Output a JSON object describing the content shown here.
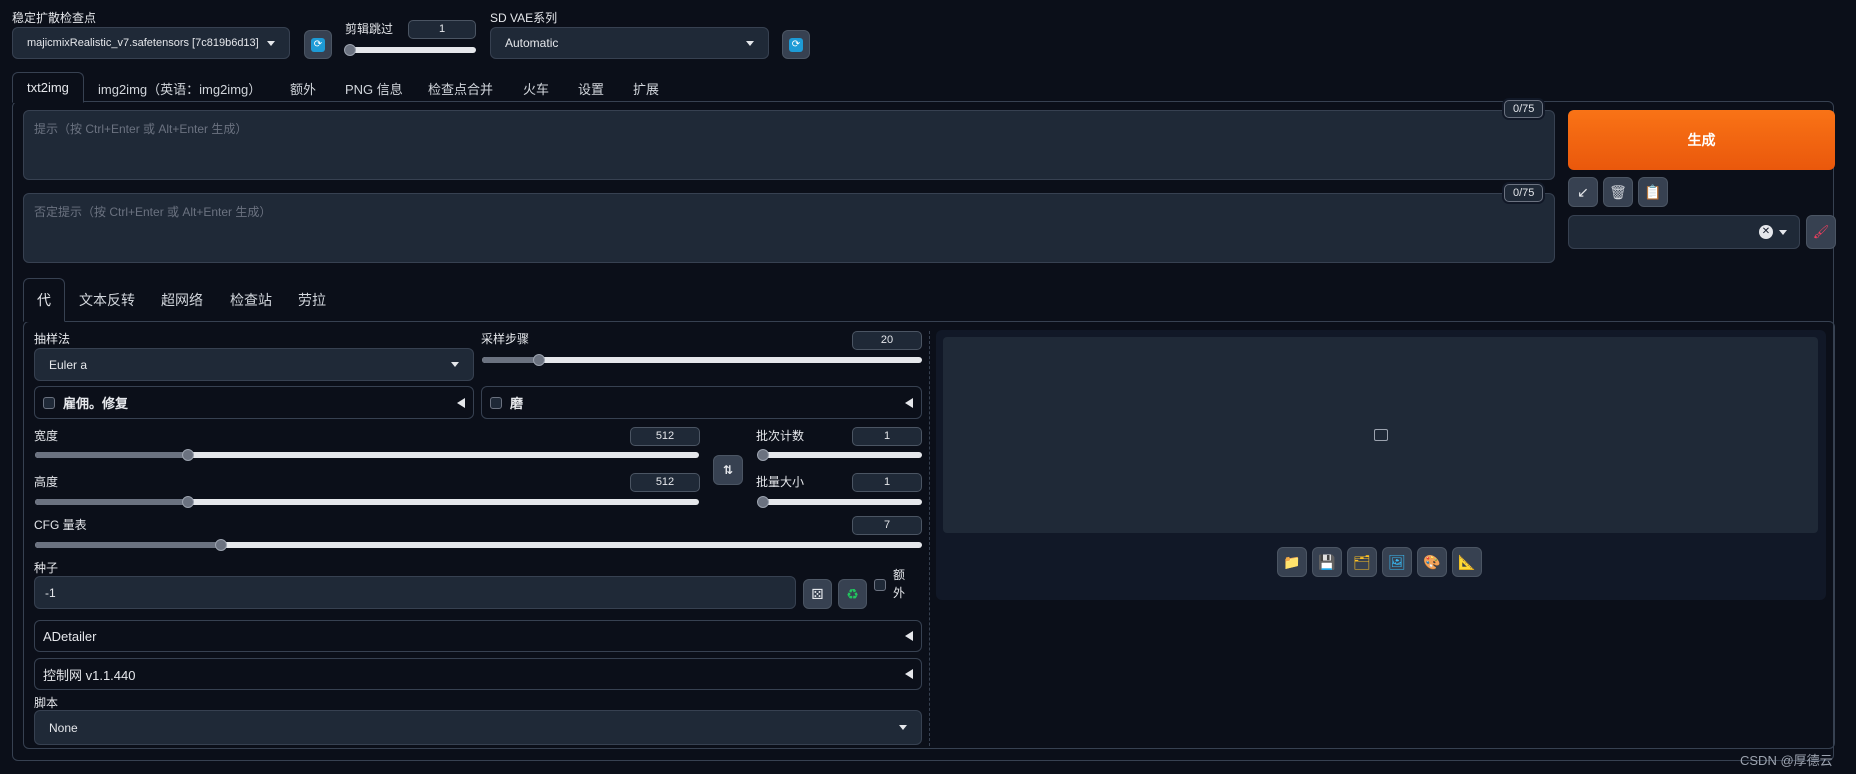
{
  "header": {
    "checkpoint_label": "稳定扩散检查点",
    "checkpoint_value": "majicmixRealistic_v7.safetensors [7c819b6d13]",
    "clip_skip_label": "剪辑跳过",
    "clip_skip_value": "1",
    "clip_skip_level": 0.0,
    "vae_label": "SD VAE系列",
    "vae_value": "Automatic"
  },
  "main_tabs": [
    "txt2img",
    "img2img（英语：img2img）",
    "额外",
    "PNG 信息",
    "检查点合并",
    "火车",
    "设置",
    "扩展"
  ],
  "prompt": {
    "placeholder": "提示（按 Ctrl+Enter 或 Alt+Enter 生成）",
    "counter": "0/75"
  },
  "negative_prompt": {
    "placeholder": "否定提示（按 Ctrl+Enter 或 Alt+Enter 生成）",
    "counter": "0/75"
  },
  "generate_label": "生成",
  "sub_tabs": [
    "代",
    "文本反转",
    "超网络",
    "检查站",
    "劳拉"
  ],
  "sampler": {
    "label": "抽样法",
    "value": "Euler a"
  },
  "steps": {
    "label": "采样步骤",
    "value": "20",
    "level": 0.13
  },
  "hires_fix_label": "雇佣。修复",
  "refiner_label": "磨",
  "width": {
    "label": "宽度",
    "value": "512",
    "level": 0.23
  },
  "height": {
    "label": "高度",
    "value": "512",
    "level": 0.23
  },
  "batch_count": {
    "label": "批次计数",
    "value": "1",
    "level": 0.0
  },
  "batch_size": {
    "label": "批量大小",
    "value": "1",
    "level": 0.0
  },
  "cfg": {
    "label": "CFG 量表",
    "value": "7",
    "level": 0.21
  },
  "seed": {
    "label": "种子",
    "value": "-1",
    "extra_label": "额外"
  },
  "adetailer_label": "ADetailer",
  "controlnet_label": "控制网 v1.1.440",
  "script": {
    "label": "脚本",
    "value": "None"
  },
  "watermark": "CSDN @厚德云",
  "colors": {
    "accent": "#ea580c",
    "background": "#0b0f19",
    "panel": "#1f2937"
  },
  "icons": {
    "refresh": "refresh-icon",
    "read_params": "arrow-icon",
    "trash": "trash-icon",
    "clipboard": "clipboard-icon",
    "brush": "brush-icon",
    "swap": "swap-icon",
    "dice": "dice-icon",
    "recycle": "recycle-icon",
    "image": "image-icon",
    "folder": "folder-icon",
    "save": "save-icon",
    "zip": "zip-icon",
    "send_img": "send-image-icon",
    "palette": "palette-icon",
    "ruler": "ruler-icon"
  }
}
